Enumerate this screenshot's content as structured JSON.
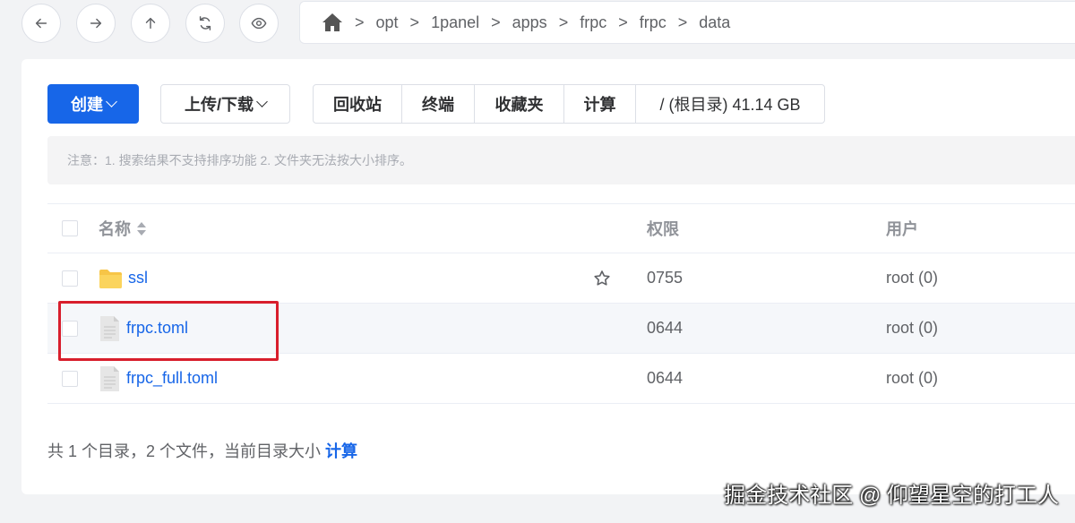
{
  "breadcrumb": [
    "opt",
    "1panel",
    "apps",
    "frpc",
    "frpc",
    "data"
  ],
  "breadcrumb_separator": ">",
  "toolbar": {
    "create_label": "创建",
    "upload_label": "上传/下载",
    "group": [
      "回收站",
      "终端",
      "收藏夹",
      "计算"
    ],
    "disk_info": "/ (根目录) 41.14 GB"
  },
  "notice": "注意：1. 搜索结果不支持排序功能 2. 文件夹无法按大小排序。",
  "table": {
    "headers": {
      "name": "名称",
      "perm": "权限",
      "user": "用户"
    },
    "rows": [
      {
        "name": "ssl",
        "type": "folder",
        "perm": "0755",
        "user": "root (0)"
      },
      {
        "name": "frpc.toml",
        "type": "file",
        "perm": "0644",
        "user": "root (0)"
      },
      {
        "name": "frpc_full.toml",
        "type": "file",
        "perm": "0644",
        "user": "root (0)"
      }
    ]
  },
  "footer": {
    "text": "共 1 个目录，2 个文件，当前目录大小 ",
    "link": "计算"
  },
  "watermark": "掘金技术社区 @ 仰望星空的打工人",
  "colors": {
    "primary": "#1766e8",
    "highlight_box": "#d81e2c",
    "folder": "#f7c547"
  }
}
